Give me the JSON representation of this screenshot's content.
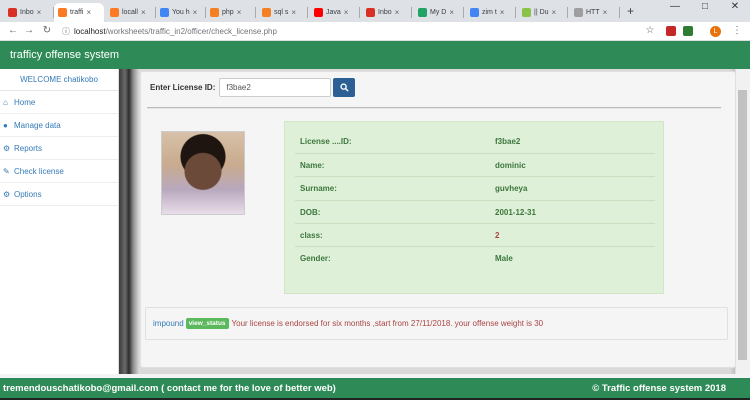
{
  "browser": {
    "tabs": [
      {
        "label": "Inbo",
        "icon": "gmail-icon",
        "color": "#d93025",
        "active": false
      },
      {
        "label": "traffi",
        "icon": "xampp-icon",
        "color": "#fb7a24",
        "active": true
      },
      {
        "label": "locall",
        "icon": "xampp-icon",
        "color": "#fb7a24",
        "active": false
      },
      {
        "label": "You h",
        "icon": "google-icon",
        "color": "#4285f4",
        "active": false
      },
      {
        "label": "php",
        "icon": "stackoverflow-icon",
        "color": "#f48024",
        "active": false
      },
      {
        "label": "sql s",
        "icon": "stackoverflow-icon",
        "color": "#f48024",
        "active": false
      },
      {
        "label": "Java",
        "icon": "youtube-icon",
        "color": "#ff0000",
        "active": false
      },
      {
        "label": "Inbo",
        "icon": "gmail-icon",
        "color": "#d93025",
        "active": false
      },
      {
        "label": "My D",
        "icon": "drive-icon",
        "color": "#1fa463",
        "active": false
      },
      {
        "label": "zim t",
        "icon": "google-icon",
        "color": "#4285f4",
        "active": false
      },
      {
        "label": "|| Du",
        "icon": "page-icon",
        "color": "#8bc34a",
        "active": false
      },
      {
        "label": "HTT",
        "icon": "page-icon",
        "color": "#9e9e9e",
        "active": false
      }
    ],
    "new_tab_label": "+",
    "url_host": "localhost",
    "url_path": "/worksheets/traffic_in2/officer/check_license.php",
    "profile_initial": "L"
  },
  "site": {
    "title": "trafficy offense system"
  },
  "sidebar": {
    "welcome": "WELCOME chatikobo",
    "items": [
      {
        "label": "Home",
        "icon": "home-icon"
      },
      {
        "label": "Manage data",
        "icon": "user-icon"
      },
      {
        "label": "Reports",
        "icon": "reports-icon"
      },
      {
        "label": "Check license",
        "icon": "license-icon"
      },
      {
        "label": "Options",
        "icon": "gear-icon"
      }
    ]
  },
  "search": {
    "label": "Enter License ID:",
    "value": "f3bae2"
  },
  "details": {
    "rows": [
      {
        "label": "License ....ID:",
        "value": "f3bae2",
        "highlight": false
      },
      {
        "label": "Name:",
        "value": "dominic",
        "highlight": false
      },
      {
        "label": "Surname:",
        "value": "guvheya",
        "highlight": false
      },
      {
        "label": "DOB:",
        "value": "2001-12-31",
        "highlight": false
      },
      {
        "label": "class:",
        "value": "2",
        "highlight": true
      },
      {
        "label": "Gender:",
        "value": "Male",
        "highlight": false
      }
    ]
  },
  "status": {
    "impound_label": "impound",
    "badge_label": "view_status",
    "message": "Your license is endorsed for six months ,start from 27/11/2018. your offense weight is 30"
  },
  "footer": {
    "left": "tremendouschatikobo@gmail.com ( contact me for the love of better web)",
    "right": "© Traffic offense system 2018"
  }
}
